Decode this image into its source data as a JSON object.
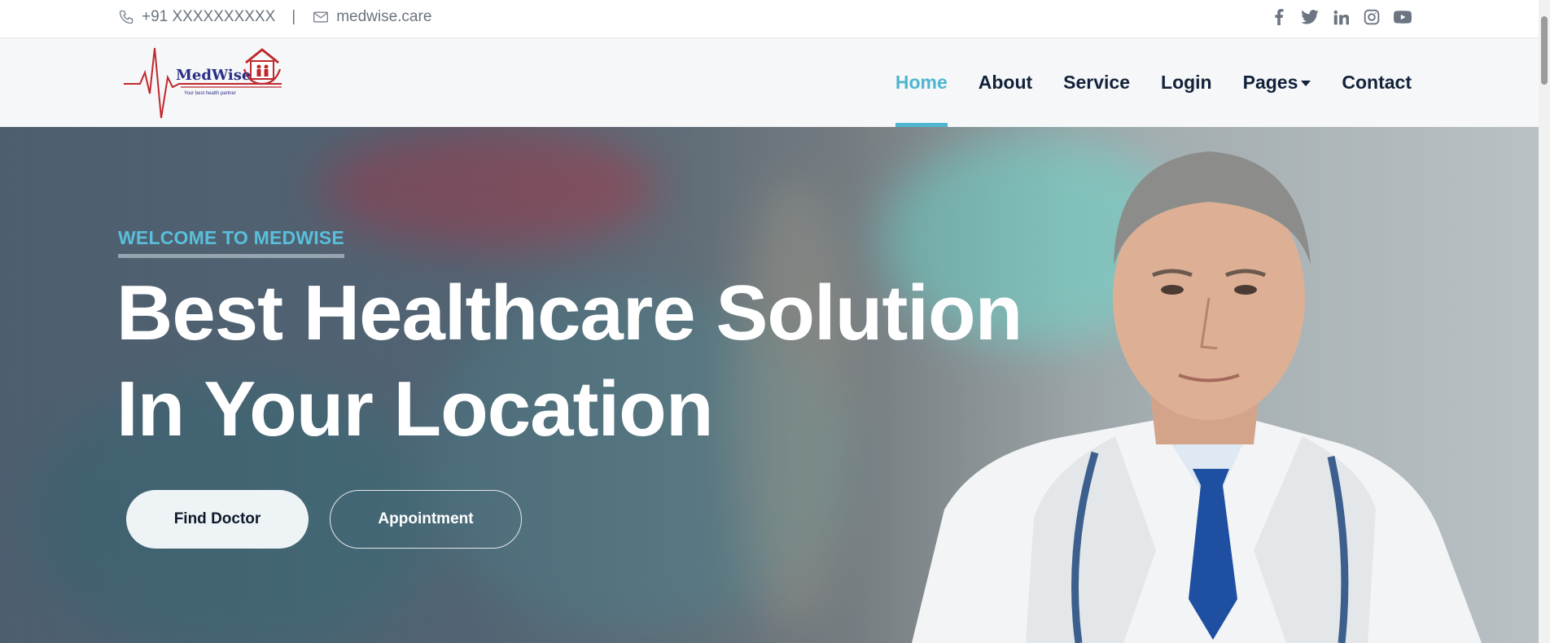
{
  "topbar": {
    "phone": "+91 XXXXXXXXXX",
    "separator": "|",
    "email": "medwise.care",
    "social_icons": [
      "facebook-icon",
      "twitter-icon",
      "linkedin-icon",
      "instagram-icon",
      "youtube-icon"
    ]
  },
  "logo": {
    "name": "MedWise",
    "tagline": "Your best health partner"
  },
  "nav": {
    "items": [
      "Home",
      "About",
      "Service",
      "Login",
      "Pages",
      "Contact"
    ],
    "active": "Home"
  },
  "hero": {
    "eyebrow": "WELCOME TO MEDWISE",
    "title_line1": "Best Healthcare Solution",
    "title_line2": "In Your Location",
    "primary_button": "Find Doctor",
    "secondary_button": "Appointment"
  },
  "colors": {
    "accent": "#4fb6cf",
    "nav_text": "#13223a",
    "topbar_text": "#6b7480",
    "logo_red": "#c0282d",
    "logo_blue": "#2b2f84"
  }
}
